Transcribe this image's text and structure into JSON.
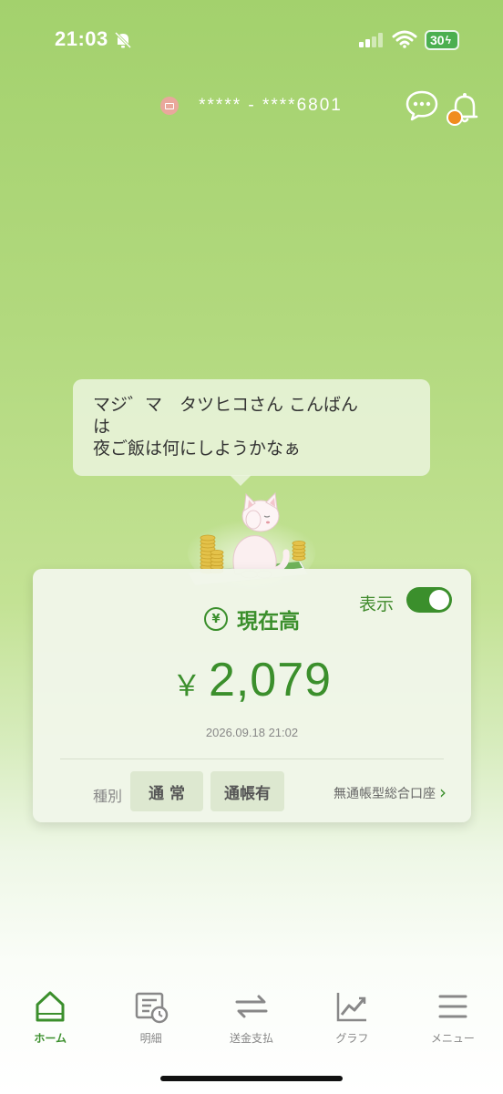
{
  "status_bar": {
    "time": "21:03",
    "battery": "30"
  },
  "header": {
    "account_number": "***** - ****6801"
  },
  "greeting": {
    "line1": "マジ゛マ　タツヒコさん こんばん",
    "line2": "は",
    "line3": "夜ご飯は何にしようかなぁ"
  },
  "balance_card": {
    "toggle_label": "表示",
    "toggle_on": true,
    "title": "現在高",
    "currency": "￥",
    "amount": "2,079",
    "timestamp": "2026.09.18 21:02",
    "type_label": "種別",
    "chip1": "通 常",
    "chip2": "通帳有",
    "account_type": "無通帳型総合口座"
  },
  "nav": [
    {
      "label": "ホーム",
      "icon": "home-icon",
      "active": true
    },
    {
      "label": "明細",
      "icon": "statement-icon",
      "active": false
    },
    {
      "label": "送金支払",
      "icon": "transfer-icon",
      "active": false
    },
    {
      "label": "グラフ",
      "icon": "graph-icon",
      "active": false
    },
    {
      "label": "メニュー",
      "icon": "menu-icon",
      "active": false
    }
  ],
  "colors": {
    "accent": "#3b8f2c",
    "notification_dot": "#f08c1f",
    "battery": "#4caf50"
  }
}
